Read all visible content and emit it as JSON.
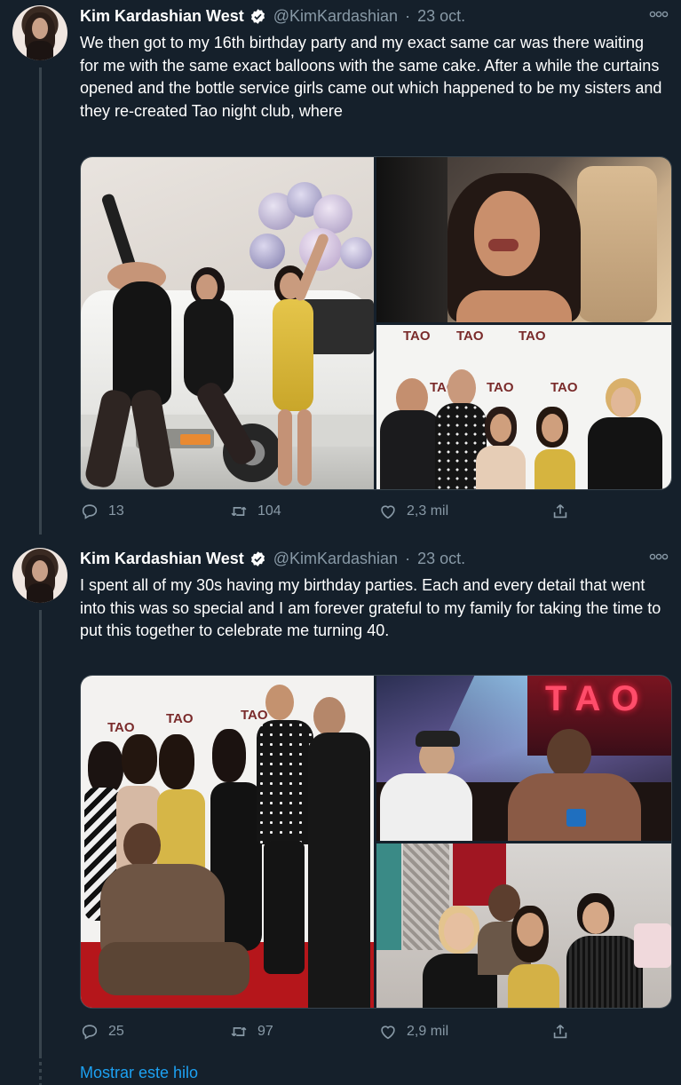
{
  "tweets": [
    {
      "author": "Kim Kardashian West",
      "handle": "@KimKardashian",
      "separator": "·",
      "date": "23 oct.",
      "text": "We then got to my 16th birthday party and my exact same car was there waiting for me with the same exact balloons with the same cake. After a while the curtains opened and the bottle service girls came out which happened to be my sisters and they re-created Tao night club, where",
      "replies": "13",
      "retweets": "104",
      "likes": "2,3 mil"
    },
    {
      "author": "Kim Kardashian West",
      "handle": "@KimKardashian",
      "separator": "·",
      "date": "23 oct.",
      "text": "I spent all of my 30s having my birthday parties. Each and every detail that went into this was so special and I am forever grateful to my family for taking the time to put this together to celebrate me turning 40.",
      "replies": "25",
      "retweets": "97",
      "likes": "2,9 mil"
    }
  ],
  "show_thread": "Mostrar este hilo",
  "tao_sign": "TAO",
  "icons": [
    "verified-badge-icon",
    "more-options-icon",
    "reply-icon",
    "retweet-icon",
    "like-icon",
    "share-icon"
  ],
  "colors": {
    "background": "#15202b",
    "secondary_text": "#8899a6",
    "accent": "#1da1f2",
    "border": "#38444d"
  }
}
